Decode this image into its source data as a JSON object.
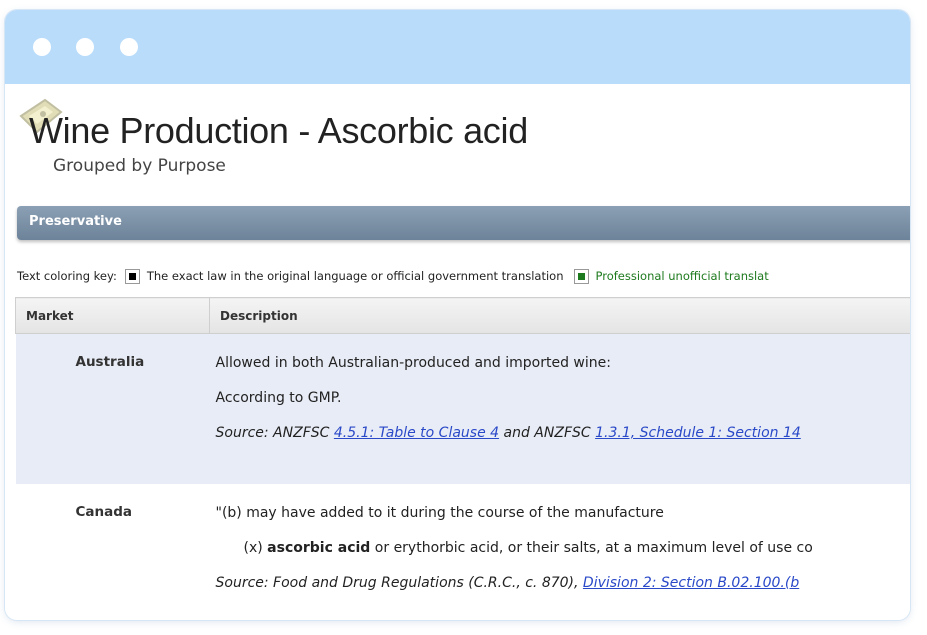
{
  "window": {
    "controls": [
      "close-dot",
      "minimize-dot",
      "zoom-dot"
    ]
  },
  "header": {
    "title": "Wine Production - Ascorbic acid",
    "subtitle": "Grouped by Purpose",
    "logo_icon": "wine-label-icon"
  },
  "section": {
    "name": "Preservative"
  },
  "key": {
    "label": "Text coloring key:",
    "exact_text": "The exact law in the original language or official government translation",
    "unofficial_text": "Professional unofficial translat",
    "exact_color": "#000000",
    "unofficial_color": "#1e7a1e"
  },
  "table": {
    "headers": [
      "Market",
      "Description"
    ],
    "rows": [
      {
        "market": "Australia",
        "line1": "Allowed in both Australian-produced and imported wine:",
        "line2": "According to GMP.",
        "source_prefix": "Source: ANZFSC ",
        "source_link1": "4.5.1: Table to Clause 4",
        "source_mid": " and ANZFSC ",
        "source_link2": "1.3.1, Schedule 1: Section 14"
      },
      {
        "market": "Canada",
        "line1": "\"(b) may have added to it during the course of the manufacture",
        "line2_prefix": "(x) ",
        "line2_bold": "ascorbic acid",
        "line2_suffix": " or erythorbic acid, or their salts, at a maximum level of use co",
        "source_prefix": "Source: Food and Drug Regulations (C.R.C., c. 870), ",
        "source_link1": "Division 2: Section B.02.100.(b"
      }
    ]
  },
  "colors": {
    "titlebar": "#b9dcfb",
    "section_bar": "#7a8fa4",
    "row_highlight": "#e8ecf6",
    "link": "#2a49c8"
  }
}
